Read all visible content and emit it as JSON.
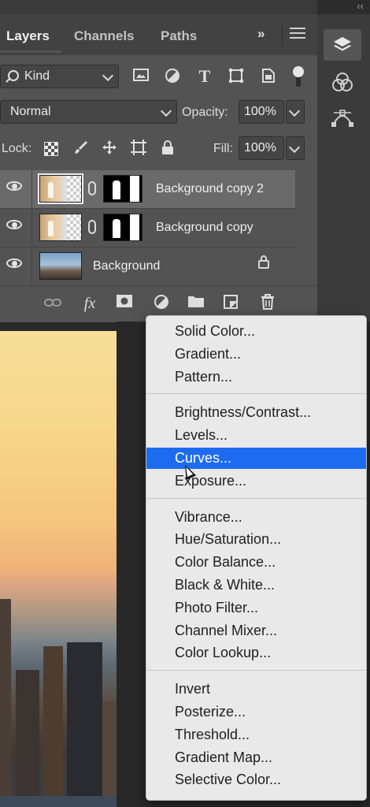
{
  "tabs": {
    "layers": "Layers",
    "channels": "Channels",
    "paths": "Paths",
    "more": "»"
  },
  "filter": {
    "kind_label": "Kind"
  },
  "blend": {
    "mode": "Normal",
    "opacity_label": "Opacity:",
    "opacity_value": "100%"
  },
  "lock": {
    "label": "Lock:",
    "fill_label": "Fill:",
    "fill_value": "100%"
  },
  "layers": [
    {
      "name": "Background copy 2",
      "selected": true
    },
    {
      "name": "Background copy",
      "selected": false
    },
    {
      "name": "Background",
      "selected": false
    }
  ],
  "bottom_bar": {
    "fx": "fx"
  },
  "right_panel": {
    "collapse": "‹‹"
  },
  "menu": {
    "groups": [
      [
        "Solid Color...",
        "Gradient...",
        "Pattern..."
      ],
      [
        "Brightness/Contrast...",
        "Levels...",
        "Curves...",
        "Exposure..."
      ],
      [
        "Vibrance...",
        "Hue/Saturation...",
        "Color Balance...",
        "Black & White...",
        "Photo Filter...",
        "Channel Mixer...",
        "Color Lookup..."
      ],
      [
        "Invert",
        "Posterize...",
        "Threshold...",
        "Gradient Map...",
        "Selective Color..."
      ]
    ],
    "highlighted": "Curves..."
  },
  "colors": {
    "panel_bg": "#535353",
    "menu_bg": "#e9e9e9",
    "highlight": "#1d6cf0"
  },
  "icons": [
    "search-icon",
    "image-filter-icon",
    "adjustment-filter-icon",
    "type-filter-icon",
    "shape-filter-icon",
    "smart-object-filter-icon",
    "filter-toggle-icon",
    "lock-transparent-icon",
    "lock-brush-icon",
    "lock-move-icon",
    "lock-artboard-icon",
    "lock-all-icon",
    "eye-icon",
    "link-icon",
    "fx-icon",
    "mask-icon",
    "adjustment-icon",
    "folder-icon",
    "new-layer-icon",
    "trash-icon",
    "layers-panel-icon",
    "channels-panel-icon",
    "paths-panel-icon"
  ]
}
